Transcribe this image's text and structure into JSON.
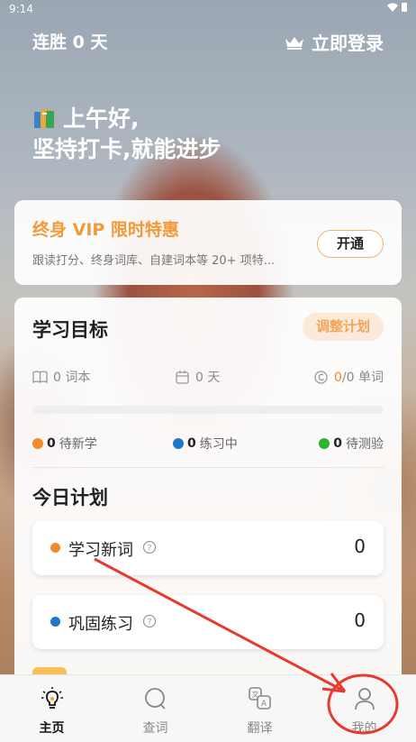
{
  "status_bar": {
    "time": "9:14"
  },
  "header": {
    "streak_label": "连胜 0 天",
    "login_label": "立即登录"
  },
  "greeting": {
    "line1": "上午好,",
    "line2": "坚持打卡,就能进步"
  },
  "vip": {
    "title": "终身 VIP 限时特惠",
    "description": "跟读打分、终身词库、自建词本等 20+ 项特...",
    "button": "开通"
  },
  "goal": {
    "title": "学习目标",
    "adjust_button": "调整计划",
    "stats": {
      "books": "0 词本",
      "days": "0 天",
      "words_done": "0",
      "words_rest": "/0 单词"
    },
    "progress_fraction": 0,
    "legend": [
      {
        "count": "0",
        "label": "待新学",
        "color": "#f08a2c"
      },
      {
        "count": "0",
        "label": "练习中",
        "color": "#1f78c8"
      },
      {
        "count": "0",
        "label": "待测验",
        "color": "#2cb52c"
      }
    ]
  },
  "today": {
    "title": "今日计划",
    "items": [
      {
        "label": "学习新词",
        "count": "0",
        "color": "#f08a2c"
      },
      {
        "label": "巩固练习",
        "count": "0",
        "color": "#1f78c8"
      }
    ]
  },
  "tabs": [
    {
      "label": "主页",
      "icon": "bulb-icon",
      "active": true
    },
    {
      "label": "查词",
      "icon": "search-icon",
      "active": false
    },
    {
      "label": "翻译",
      "icon": "translate-icon",
      "active": false
    },
    {
      "label": "我的",
      "icon": "person-icon",
      "active": false
    }
  ],
  "annotation": {
    "color": "#e8392c"
  }
}
